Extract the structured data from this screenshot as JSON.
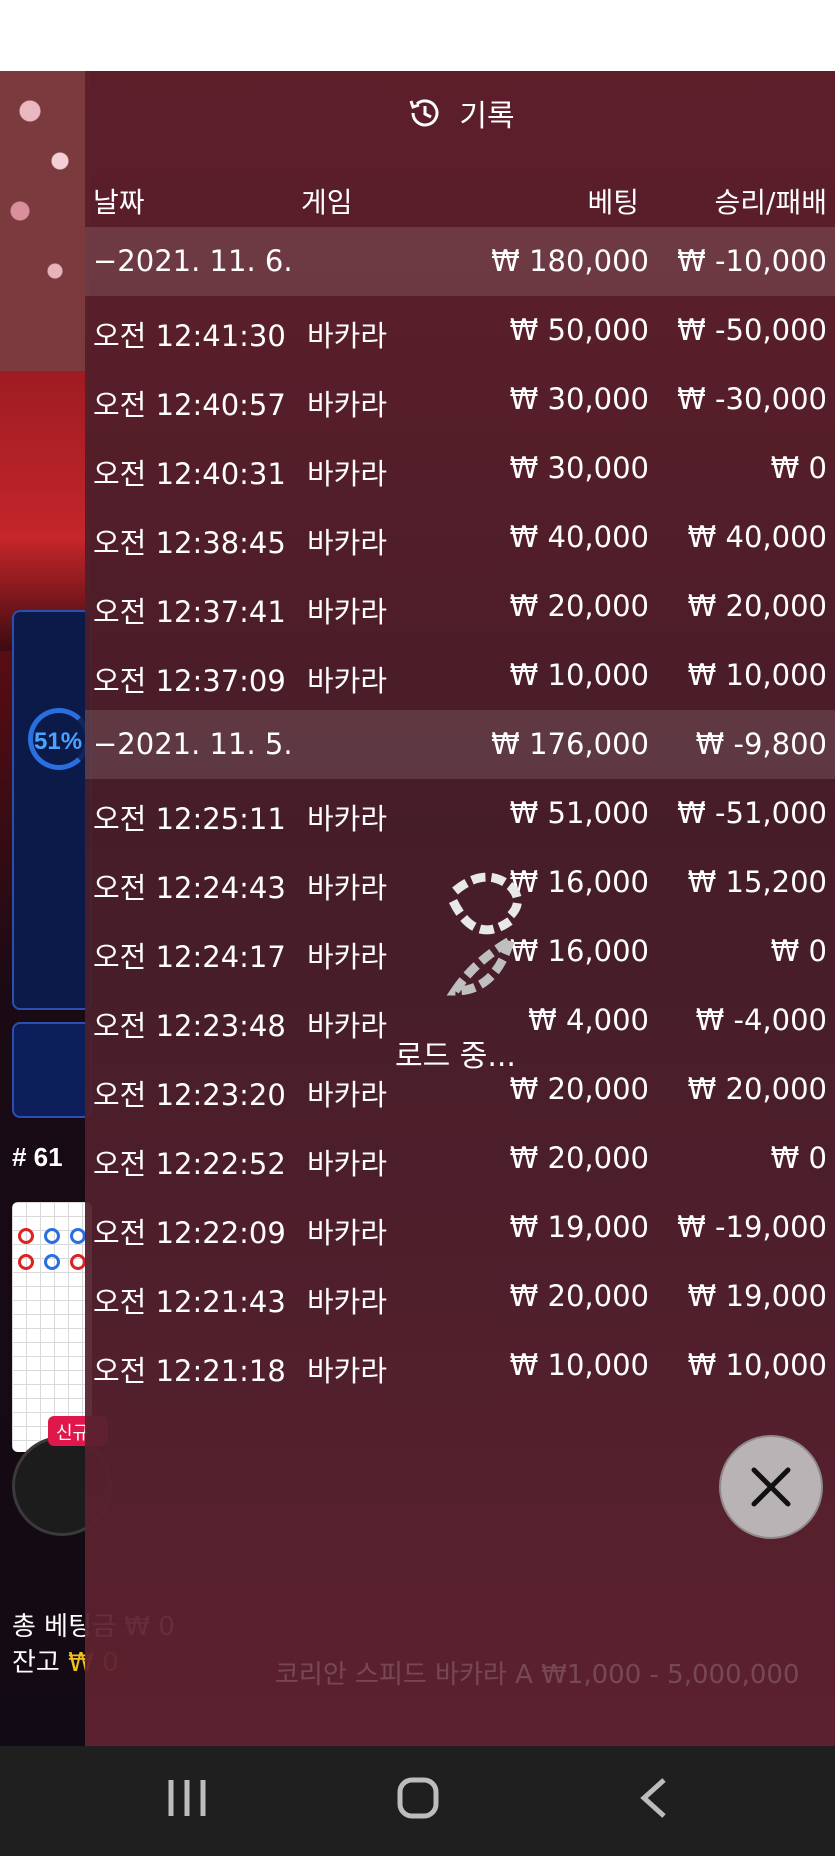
{
  "header": {
    "title": "기록",
    "icon": "history-clock-icon"
  },
  "columns": {
    "date": "날짜",
    "game": "게임",
    "bet": "베팅",
    "win_loss": "승리/패배"
  },
  "groups": [
    {
      "date": "−2021. 11. 6.",
      "total_bet": "₩ 180,000",
      "total_result": "₩ -10,000",
      "rows": [
        {
          "time": "오전 12:41:30",
          "game": "바카라",
          "bet": "₩ 50,000",
          "result": "₩ -50,000"
        },
        {
          "time": "오전 12:40:57",
          "game": "바카라",
          "bet": "₩ 30,000",
          "result": "₩ -30,000"
        },
        {
          "time": "오전 12:40:31",
          "game": "바카라",
          "bet": "₩ 30,000",
          "result": "₩ 0"
        },
        {
          "time": "오전 12:38:45",
          "game": "바카라",
          "bet": "₩ 40,000",
          "result": "₩ 40,000"
        },
        {
          "time": "오전 12:37:41",
          "game": "바카라",
          "bet": "₩ 20,000",
          "result": "₩ 20,000"
        },
        {
          "time": "오전 12:37:09",
          "game": "바카라",
          "bet": "₩ 10,000",
          "result": "₩ 10,000"
        }
      ]
    },
    {
      "date": "−2021. 11. 5.",
      "total_bet": "₩ 176,000",
      "total_result": "₩ -9,800",
      "rows": [
        {
          "time": "오전 12:25:11",
          "game": "바카라",
          "bet": "₩ 51,000",
          "result": "₩ -51,000"
        },
        {
          "time": "오전 12:24:43",
          "game": "바카라",
          "bet": "₩ 16,000",
          "result": "₩ 15,200"
        },
        {
          "time": "오전 12:24:17",
          "game": "바카라",
          "bet": "₩ 16,000",
          "result": "₩ 0"
        },
        {
          "time": "오전 12:23:48",
          "game": "바카라",
          "bet": "₩ 4,000",
          "result": "₩ -4,000"
        },
        {
          "time": "오전 12:23:20",
          "game": "바카라",
          "bet": "₩ 20,000",
          "result": "₩ 20,000"
        },
        {
          "time": "오전 12:22:52",
          "game": "바카라",
          "bet": "₩ 20,000",
          "result": "₩ 0"
        },
        {
          "time": "오전 12:22:09",
          "game": "바카라",
          "bet": "₩ 19,000",
          "result": "₩ -19,000"
        },
        {
          "time": "오전 12:21:43",
          "game": "바카라",
          "bet": "₩ 20,000",
          "result": "₩ 19,000"
        },
        {
          "time": "오전 12:21:18",
          "game": "바카라",
          "bet": "₩ 10,000",
          "result": "₩ 10,000"
        }
      ]
    }
  ],
  "loading": {
    "text": "로드 중..."
  },
  "background": {
    "percent": "51%",
    "round": "# 61",
    "new_badge": "신규",
    "total_bet_label": "총 베팅금",
    "total_bet_value": "₩ 0",
    "balance_label": "잔고",
    "balance_value": "₩ 0",
    "table_info": "코리안 스피드 바카라 A ₩1,000 - 5,000,000"
  },
  "colors": {
    "overlay": "#5c1e2a",
    "accent_blue": "#2a6fe0",
    "badge_red": "#e0174a",
    "gold": "#f0c020"
  },
  "navbar": {
    "recent": "recent-apps-icon",
    "home": "home-icon",
    "back": "back-icon"
  }
}
